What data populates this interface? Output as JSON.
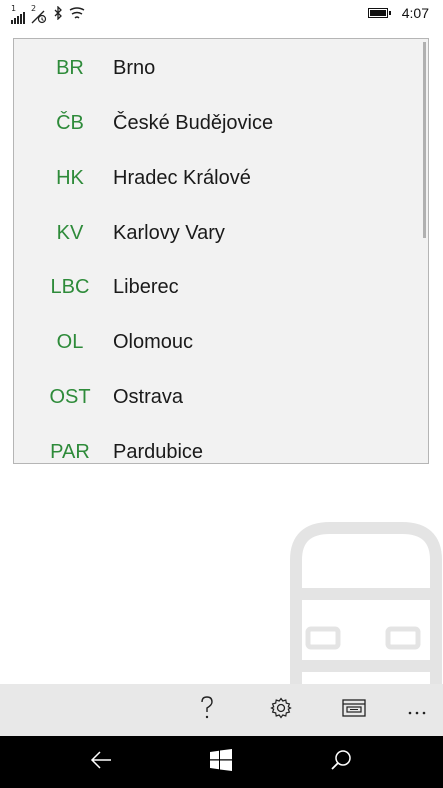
{
  "status_bar": {
    "sim1_label": "1",
    "sim2_label": "2",
    "time": "4:07",
    "icons": [
      "signal-icon",
      "signal-icon",
      "bluetooth-icon",
      "wifi-icon",
      "battery-icon"
    ]
  },
  "cities": [
    {
      "code": "BR",
      "name": "Brno"
    },
    {
      "code": "ČB",
      "name": "České Budějovice"
    },
    {
      "code": "HK",
      "name": "Hradec Králové"
    },
    {
      "code": "KV",
      "name": "Karlovy Vary"
    },
    {
      "code": "LBC",
      "name": "Liberec"
    },
    {
      "code": "OL",
      "name": "Olomouc"
    },
    {
      "code": "OST",
      "name": "Ostrava"
    },
    {
      "code": "PAR",
      "name": "Pardubice"
    }
  ],
  "app_bar": {
    "icons": [
      "help-icon",
      "settings-icon",
      "ticket-icon",
      "more-icon"
    ]
  },
  "nav_bar": {
    "icons": [
      "back-icon",
      "windows-icon",
      "search-icon"
    ]
  },
  "colors": {
    "code_green": "#2e8b3a",
    "list_bg": "#f2f2f2",
    "app_bar_bg": "#e8e8e8",
    "watermark": "#e6e6e6"
  }
}
